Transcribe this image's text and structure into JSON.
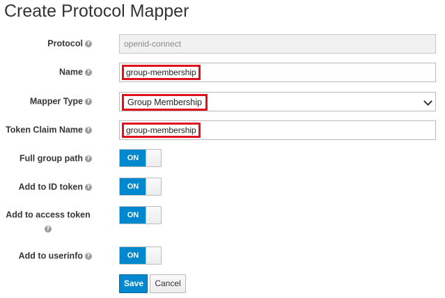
{
  "page": {
    "title": "Create Protocol Mapper"
  },
  "form": {
    "protocol": {
      "label": "Protocol",
      "value": "openid-connect"
    },
    "name": {
      "label": "Name",
      "value": "group-membership"
    },
    "mapper_type": {
      "label": "Mapper Type",
      "value": "Group Membership"
    },
    "token_claim_name": {
      "label": "Token Claim Name",
      "value": "group-membership"
    },
    "full_group_path": {
      "label": "Full group path",
      "state": "ON"
    },
    "add_to_id_token": {
      "label": "Add to ID token",
      "state": "ON"
    },
    "add_to_access_token": {
      "label": "Add to access token",
      "state": "ON"
    },
    "add_to_userinfo": {
      "label": "Add to userinfo",
      "state": "ON"
    }
  },
  "icons": {
    "help": "question-circle-icon",
    "dropdown": "chevron-down-icon"
  },
  "help_glyph": "?",
  "buttons": {
    "save": "Save",
    "cancel": "Cancel"
  },
  "colors": {
    "primary": "#0088ce",
    "highlight": "#e0101c"
  }
}
